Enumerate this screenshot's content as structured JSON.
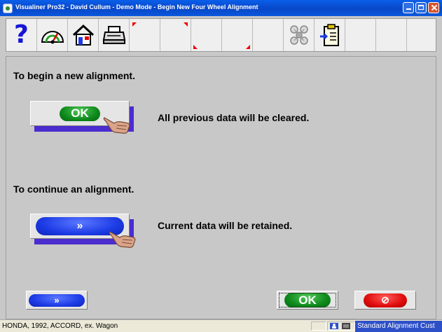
{
  "window": {
    "title": "Visualiner Pro32 - David Cullum - Demo Mode - Begin New Four Wheel Alignment"
  },
  "toolbar": {
    "buttons": [
      {
        "name": "help",
        "icon": "help-question-icon",
        "glyph": "?"
      },
      {
        "name": "gauge",
        "icon": "gauge-icon"
      },
      {
        "name": "home",
        "icon": "home-icon"
      },
      {
        "name": "print",
        "icon": "printer-icon"
      },
      {
        "name": "blank-1",
        "icon": "corner-marker-icon"
      },
      {
        "name": "blank-2",
        "icon": "corner-marker-icon"
      },
      {
        "name": "blank-3",
        "icon": "corner-marker-icon"
      },
      {
        "name": "blank-4",
        "icon": "corner-marker-icon"
      },
      {
        "name": "blank-5",
        "icon": ""
      },
      {
        "name": "vehicle-dna",
        "icon": "vehicle-dna-icon"
      },
      {
        "name": "import-clipboard",
        "icon": "clipboard-import-icon"
      }
    ]
  },
  "main": {
    "begin_heading": "To begin a new alignment.",
    "begin_button_label": "OK",
    "begin_note": "All previous data will be cleared.",
    "continue_heading": "To continue an alignment.",
    "continue_button_label": "»",
    "continue_note": "Current data will be retained."
  },
  "bottom": {
    "next_label": "»",
    "ok_label": "OK",
    "cancel_label": "⊘"
  },
  "status": {
    "vehicle": "HONDA, 1992, ACCORD, ex. Wagon",
    "mode": "Standard Alignment Cust"
  },
  "colors": {
    "title_bar": "#0847c9",
    "ok_green": "#0e8a1c",
    "continue_blue": "#1d3ce6",
    "cancel_red": "#e10d0d",
    "button_shadow": "#4b2ccf"
  }
}
